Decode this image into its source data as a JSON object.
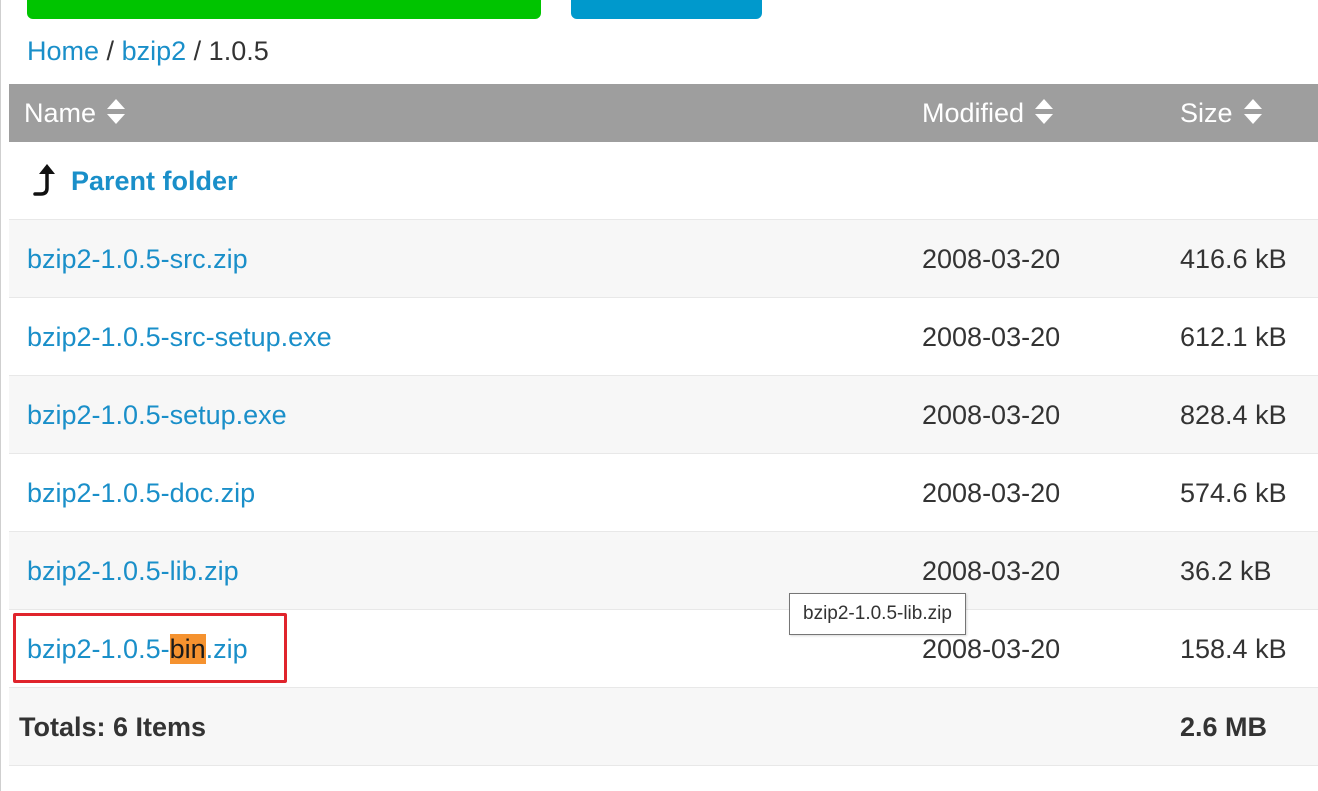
{
  "breadcrumb": {
    "home": "Home",
    "folder": "bzip2",
    "current": "1.0.5",
    "separator": "/"
  },
  "table": {
    "headers": {
      "name": "Name",
      "modified": "Modified",
      "size": "Size"
    },
    "parent_label": "Parent folder",
    "rows": [
      {
        "name": "bzip2-1.0.5-src.zip",
        "modified": "2008-03-20",
        "size": "416.6 kB"
      },
      {
        "name": "bzip2-1.0.5-src-setup.exe",
        "modified": "2008-03-20",
        "size": "612.1 kB"
      },
      {
        "name": "bzip2-1.0.5-setup.exe",
        "modified": "2008-03-20",
        "size": "828.4 kB"
      },
      {
        "name": "bzip2-1.0.5-doc.zip",
        "modified": "2008-03-20",
        "size": "574.6 kB"
      },
      {
        "name": "bzip2-1.0.5-lib.zip",
        "modified": "2008-03-20",
        "size": "36.2 kB"
      },
      {
        "name_prefix": "bzip2-1.0.5-",
        "name_highlight": "bin",
        "name_suffix": ".zip",
        "modified": "2008-03-20",
        "size": "158.4 kB"
      }
    ],
    "totals_label": "Totals: 6 Items",
    "totals_size": "2.6 MB"
  },
  "tooltip": "bzip2-1.0.5-lib.zip",
  "colors": {
    "link": "#1a8fc9",
    "header_bg": "#9e9e9e",
    "highlight": "#f5922f",
    "annotation_box": "#e0242c",
    "top_button_green": "#00c400",
    "top_button_blue": "#0099cc"
  },
  "icons": {
    "sort": "sort-icon",
    "parent": "parent-folder-arrow-icon"
  }
}
